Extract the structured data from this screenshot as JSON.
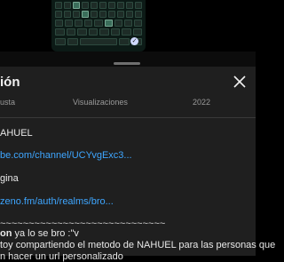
{
  "video": {
    "check_glyph": "✓"
  },
  "panel": {
    "title": "ión",
    "stats": [
      "usta",
      "Visualizaciones",
      "2022"
    ],
    "description": {
      "line1": "AHUEL",
      "link1": "be.com/channel/UCYvgExc3...",
      "line2": "gina",
      "link2": "zeno.fm/auth/realms/bro...",
      "separator": "~~~~~~~~~~~~~~~~~~~~~~~~~~~~~",
      "comment_author": "on",
      "comment_text": " ya lo se bro :\"v",
      "line3": "toy compartiendo el metodo de NAHUEL para las personas que",
      "line4": "n hacer un url personalizado"
    }
  },
  "colors": {
    "panel_bg": "#1f1f1f",
    "link": "#3ea6ff",
    "muted": "#9a9a9a"
  }
}
